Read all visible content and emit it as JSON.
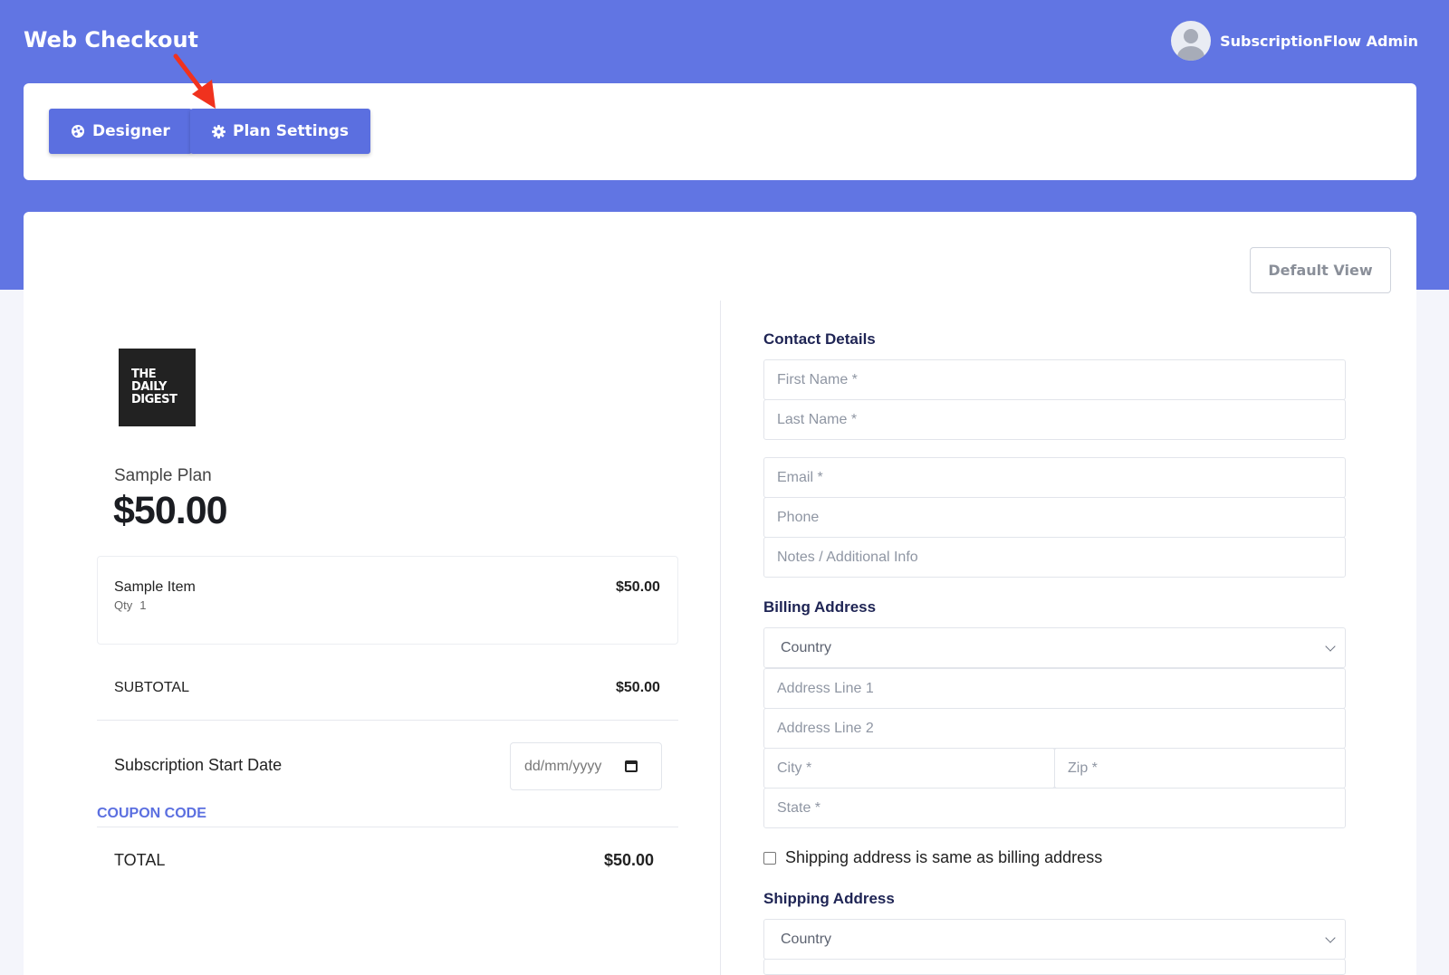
{
  "header": {
    "title": "Web Checkout",
    "user_name": "SubscriptionFlow Admin"
  },
  "toolbar": {
    "designer_label": "Designer",
    "plan_settings_label": "Plan Settings"
  },
  "view_toggle": {
    "label": "Default View"
  },
  "summary": {
    "logo_lines": [
      "THE",
      "DAILY",
      "DIGEST"
    ],
    "plan_name": "Sample Plan",
    "plan_price": "$50.00",
    "item": {
      "name": "Sample Item",
      "qty_label": "Qty",
      "qty": "1",
      "price": "$50.00"
    },
    "subtotal_label": "SUBTOTAL",
    "subtotal_value": "$50.00",
    "start_date_label": "Subscription Start Date",
    "start_date_placeholder": "dd/mm/yyyy",
    "coupon_label": "COUPON CODE",
    "total_label": "TOTAL",
    "total_value": "$50.00"
  },
  "contact": {
    "title": "Contact Details",
    "first_name": "First Name *",
    "last_name": "Last Name *",
    "email": "Email *",
    "phone": "Phone",
    "notes": "Notes / Additional Info"
  },
  "billing": {
    "title": "Billing Address",
    "country": "Country",
    "address1": "Address Line 1",
    "address2": "Address Line 2",
    "city": "City *",
    "zip": "Zip *",
    "state": "State *",
    "same_as_label": "Shipping address is same as billing address"
  },
  "shipping": {
    "title": "Shipping Address",
    "country": "Country"
  },
  "colors": {
    "brand": "#6175e3",
    "button": "#5b6fe0",
    "annotation_arrow": "#f0321e",
    "section_title": "#1e2454"
  }
}
